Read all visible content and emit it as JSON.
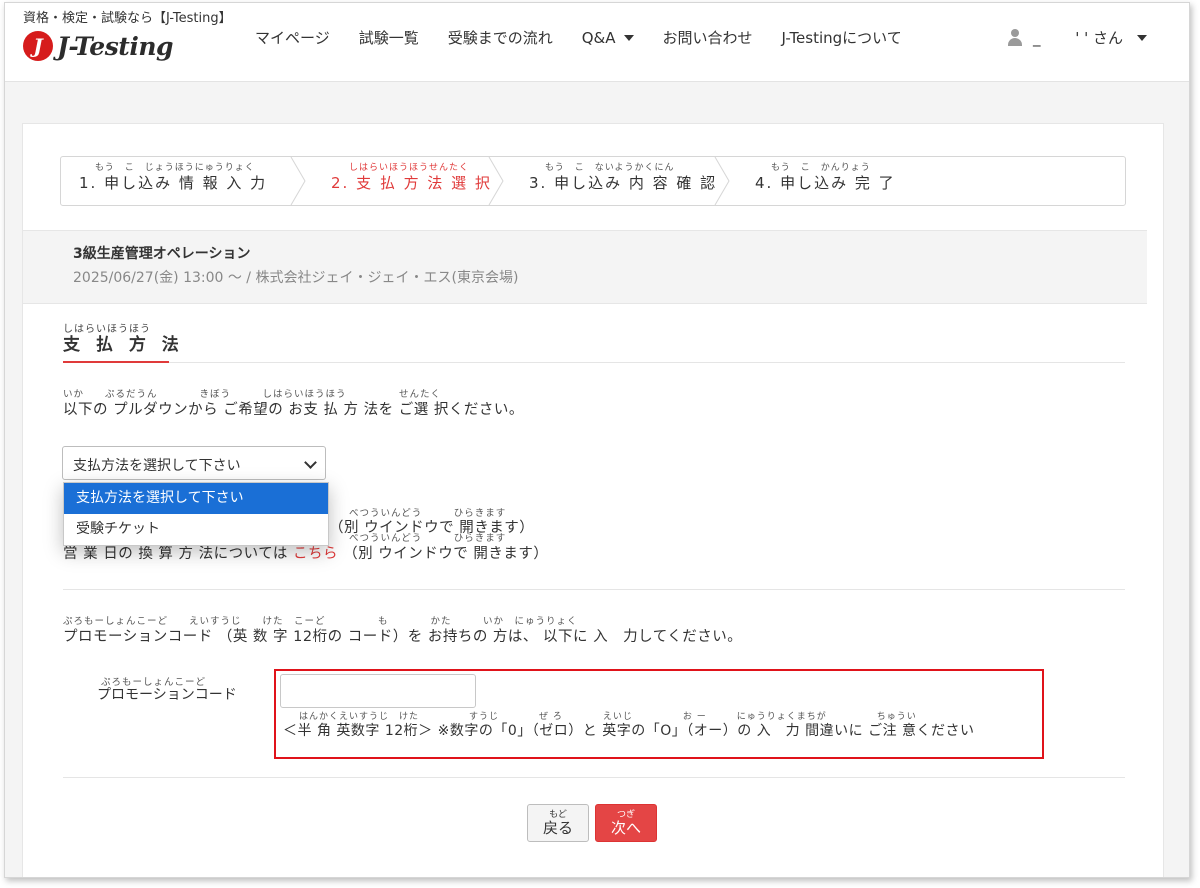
{
  "header": {
    "tagline": "資格・検定・試験なら【J-Testing】",
    "logo_mark": "J",
    "logo_text": "J-Testing",
    "nav": [
      {
        "label": "マイページ"
      },
      {
        "label": "試験一覧"
      },
      {
        "label": "受験までの流れ"
      },
      {
        "label": "Q&A"
      },
      {
        "label": "お問い合わせ"
      },
      {
        "label": "J-Testingについて"
      }
    ],
    "user_label": "_　　 ' ' さん"
  },
  "steps": [
    {
      "ruby": "もう　こ　じょうほうにゅうりょく",
      "label": "1. 申し込み 情 報 入 力"
    },
    {
      "ruby": "しはらいほうほうせんたく",
      "label": "2. 支 払 方 法 選 択"
    },
    {
      "ruby": "もう　こ　ないようかくにん",
      "label": "3. 申し込み 内 容 確 認"
    },
    {
      "ruby": "もう　こ　かんりょう",
      "label": "4. 申し込み 完 了"
    }
  ],
  "exam": {
    "name": "3級生産管理オペレーション",
    "detail": "2025/06/27(金) 13:00 ～ / 株式会社ジェイ・ジェイ・エス(東京会場)"
  },
  "payment": {
    "title_ruby": "しはらいほうほう",
    "title": "支 払 方 法",
    "instruction_ruby": "いか　　ぷるだうん　　　　きぼう　　　しはらいほうほう　　　　　せんたく",
    "instruction": "以下の プルダウンから ご希望の お支 払 方 法を ご選 択ください。",
    "select_value": "支払方法を選択して下さい",
    "options": [
      {
        "label": "支払方法を選択して下さい"
      },
      {
        "label": "受験チケット"
      }
    ],
    "note1_ruby": "べつういんどう　　　ひらきます",
    "note1_text": "（別 ウインドウで 開きます）",
    "note2_ruby": "べつういんどう　　　ひらきます",
    "note2_pre": "営 業 日の 換 算 方 法については",
    "note2_link": "こちら",
    "note2_post": "（別 ウインドウで 開きます）"
  },
  "promo": {
    "instruction_ruby": "ぷろもーしょんこーど　　えいすうじ　　けた　こーど　　　　　も　　　　かた　　　いか　にゅうりょく",
    "instruction": "プロモーションコード （英 数 字 12桁の コード）を お持ちの 方は、 以下に 入　力してください。",
    "label_ruby": "ぷろもーしょんこーど",
    "label": "プロモーションコード",
    "input_value": "",
    "hint_ruby": "はんかくえいすうじ　けた　　　　　すうじ　　　　ぜ ろ　　　　えいじ　　　　　お ー　　　にゅうりょくまちが　　　　　ちゅうい",
    "hint": "＜半 角 英数字 12桁＞ ※数字の「0」（ゼロ）と 英字の「O」（オー）の 入　力 間違いに ご注 意ください"
  },
  "buttons": {
    "back_ruby": "もど",
    "back": "戻る",
    "next_ruby": "つぎ",
    "next": "次へ"
  },
  "colors": {
    "accent": "#e03a3a",
    "highlight_border": "#e0131a",
    "selected_option": "#1a6fd6",
    "next_button": "#e44545"
  }
}
